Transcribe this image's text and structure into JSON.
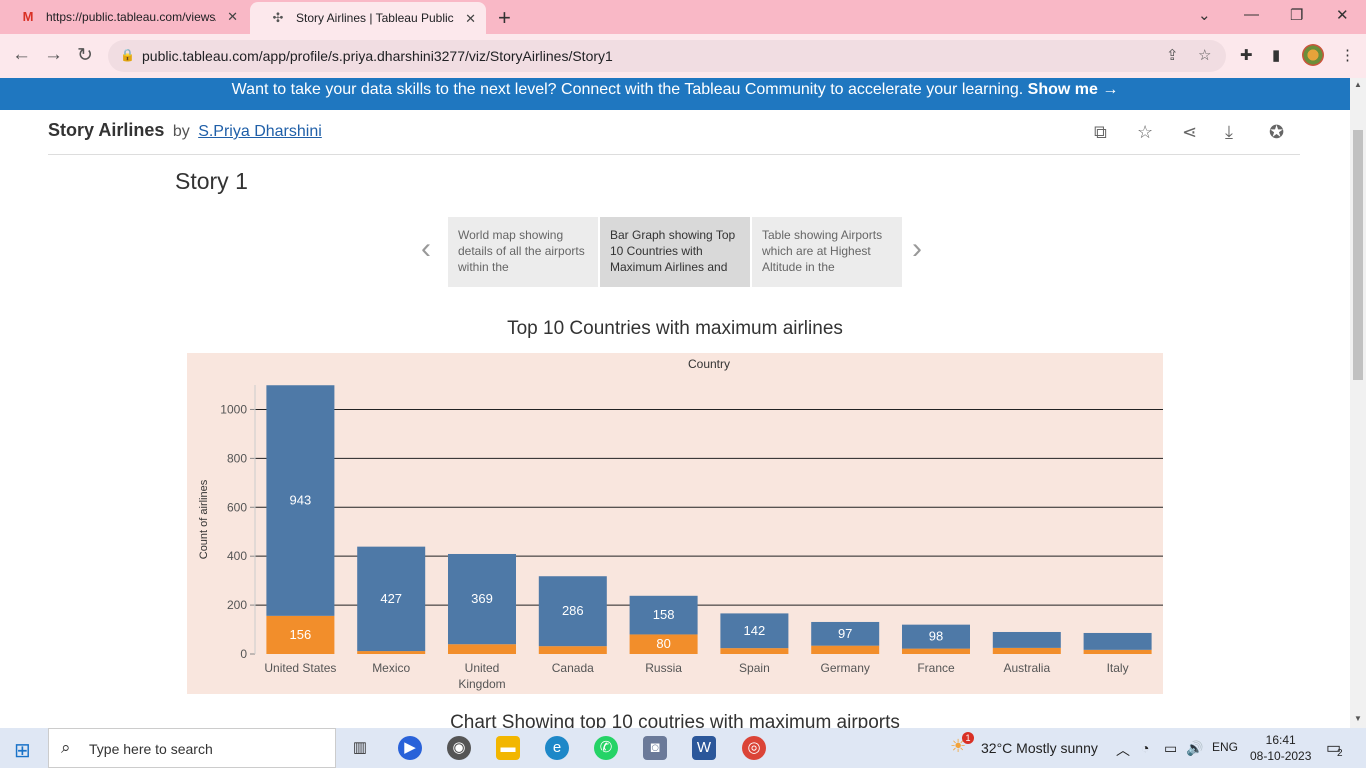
{
  "browser": {
    "tabs": [
      {
        "title": "https://public.tableau.com/views/",
        "icon": "gmail-icon"
      },
      {
        "title": "Story Airlines | Tableau Public",
        "icon": "tableau-icon"
      }
    ],
    "url": "public.tableau.com/app/profile/s.priya.dharshini3277/viz/StoryAirlines/Story1"
  },
  "banner": {
    "text": "Want to take your data skills to the next level? Connect with the Tableau Community to accelerate your learning.",
    "link": "Show me →"
  },
  "viz": {
    "title": "Story Airlines",
    "by": "by",
    "author": "S.Priya Dharshini"
  },
  "story": {
    "title": "Story 1",
    "points": [
      "World map showing details of all the airports within the",
      "Bar Graph showing Top 10 Countries with Maximum Airlines and",
      "Table showing Airports which are at Highest Altitude in the"
    ],
    "active_point": 1
  },
  "chart_data": {
    "type": "bar",
    "title": "Top 10 Countries with maximum airlines",
    "header": "Country",
    "ylabel": "Count of airlines",
    "ylim": [
      0,
      1100
    ],
    "yticks": [
      0,
      200,
      400,
      600,
      800,
      1000
    ],
    "categories": [
      "United States",
      "Mexico",
      "United Kingdom",
      "Canada",
      "Russia",
      "Spain",
      "Germany",
      "France",
      "Australia",
      "Italy"
    ],
    "category_lines": [
      [
        "United States"
      ],
      [
        "Mexico"
      ],
      [
        "United",
        "Kingdom"
      ],
      [
        "Canada"
      ],
      [
        "Russia"
      ],
      [
        "Spain"
      ],
      [
        "Germany"
      ],
      [
        "France"
      ],
      [
        "Australia"
      ],
      [
        "Italy"
      ]
    ],
    "series": [
      {
        "values": [
          156,
          12,
          40,
          32,
          80,
          24,
          34,
          22,
          25,
          17
        ],
        "color": "#f28e2b"
      },
      {
        "values": [
          943,
          427,
          369,
          286,
          158,
          142,
          97,
          98,
          65,
          69
        ],
        "color": "#4e79a7"
      }
    ],
    "labels": [
      [
        "156",
        "",
        "",
        "",
        "80",
        "",
        "",
        "",
        "",
        ""
      ],
      [
        "943",
        "427",
        "369",
        "286",
        "158",
        "142",
        "97",
        "98",
        "",
        ""
      ]
    ]
  },
  "next_chart_title": "Chart Showing top 10 coutries with maximum airports",
  "taskbar": {
    "search_placeholder": "Type here to search",
    "weather": "32°C  Mostly sunny",
    "lang": "ENG",
    "time": "16:41",
    "date": "08-10-2023",
    "notifications": "2",
    "weather_badge": "1"
  }
}
